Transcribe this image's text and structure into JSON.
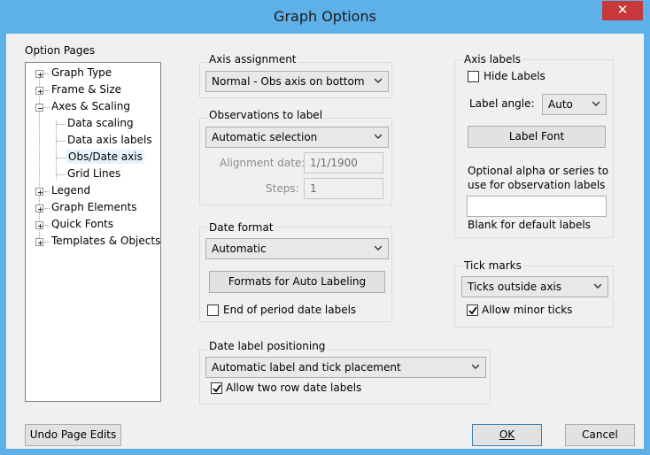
{
  "window": {
    "title": "Graph Options",
    "close_glyph": "✕"
  },
  "option_pages": {
    "label": "Option Pages",
    "items": [
      {
        "label": "Graph Type",
        "expander": "+"
      },
      {
        "label": "Frame & Size",
        "expander": "+"
      },
      {
        "label": "Axes & Scaling",
        "expander": "−",
        "children": [
          "Data scaling",
          "Data axis labels",
          "Obs/Date axis",
          "Grid Lines"
        ],
        "selected_child": "Obs/Date axis"
      },
      {
        "label": "Legend",
        "expander": "+"
      },
      {
        "label": "Graph Elements",
        "expander": "+"
      },
      {
        "label": "Quick Fonts",
        "expander": "+"
      },
      {
        "label": "Templates & Objects",
        "expander": "+"
      }
    ]
  },
  "axis_assignment": {
    "label": "Axis assignment",
    "value": "Normal - Obs axis on bottom"
  },
  "observations_to_label": {
    "label": "Observations to label",
    "value": "Automatic selection",
    "alignment_date_label": "Alignment date:",
    "alignment_date_value": "1/1/1900",
    "steps_label": "Steps:",
    "steps_value": "1"
  },
  "date_format": {
    "label": "Date format",
    "value": "Automatic",
    "formats_button": "Formats for Auto Labeling",
    "end_of_period_label": "End of period date labels",
    "end_of_period_checked": false
  },
  "date_label_positioning": {
    "label": "Date label positioning",
    "value": "Automatic label and tick placement",
    "two_row_label": "Allow two row date labels",
    "two_row_checked": true
  },
  "axis_labels": {
    "label": "Axis labels",
    "hide_labels_label": "Hide Labels",
    "hide_labels_checked": false,
    "label_angle_label": "Label angle:",
    "label_angle_value": "Auto",
    "label_font_button": "Label Font",
    "optional_text_line1": "Optional alpha or series to",
    "optional_text_line2": "use for observation labels",
    "optional_input_value": "",
    "blank_hint": "Blank for default labels"
  },
  "tick_marks": {
    "label": "Tick marks",
    "value": "Ticks outside axis",
    "allow_minor_label": "Allow minor ticks",
    "allow_minor_checked": true
  },
  "buttons": {
    "undo": "Undo Page Edits",
    "ok": "OK",
    "cancel": "Cancel"
  },
  "colors": {
    "titlebar": "#5eb0e8",
    "close": "#c7383a",
    "dialog": "#f0f0f0"
  }
}
